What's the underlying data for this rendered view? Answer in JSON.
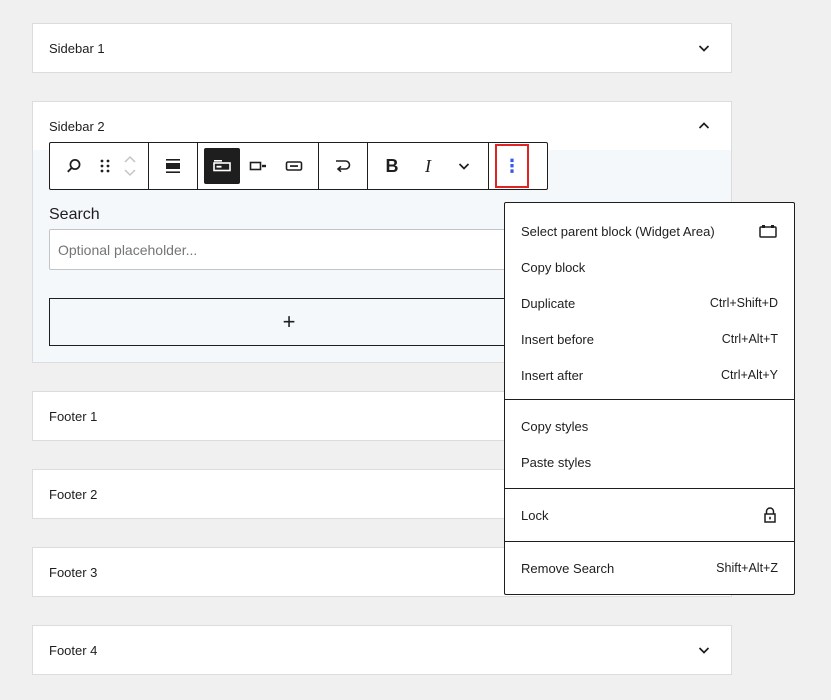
{
  "panels": {
    "sidebar1": "Sidebar 1",
    "sidebar2": "Sidebar 2",
    "footer1": "Footer 1",
    "footer2": "Footer 2",
    "footer3": "Footer 3",
    "footer4": "Footer 4"
  },
  "toolbar": {
    "icons": [
      "search-icon",
      "drag-handle-icon",
      "move-up-icon",
      "move-down-icon",
      "align-icon",
      "button-position-outside-icon",
      "button-position-inside-icon",
      "button-only-icon",
      "link-wrap-icon",
      "bold-icon",
      "italic-icon",
      "more-formatting-icon",
      "options-icon"
    ],
    "bold": "B",
    "italic": "I",
    "more": "⋮"
  },
  "search_block": {
    "label": "Search",
    "placeholder": "Optional placeholder...",
    "value": "",
    "appender": "+"
  },
  "menu": {
    "group1": [
      {
        "label": "Select parent block (Widget Area)",
        "shortcut": ""
      },
      {
        "label": "Copy block",
        "shortcut": ""
      },
      {
        "label": "Duplicate",
        "shortcut": "Ctrl+Shift+D"
      },
      {
        "label": "Insert before",
        "shortcut": "Ctrl+Alt+T"
      },
      {
        "label": "Insert after",
        "shortcut": "Ctrl+Alt+Y"
      }
    ],
    "group2": [
      {
        "label": "Copy styles"
      },
      {
        "label": "Paste styles"
      }
    ],
    "group3": [
      {
        "label": "Lock"
      }
    ],
    "group4": [
      {
        "label": "Remove Search",
        "shortcut": "Shift+Alt+Z"
      }
    ]
  },
  "colors": {
    "accent": "#3858e9",
    "highlight": "#e02424",
    "text": "#1e1e1e",
    "background": "#f0f0f0"
  }
}
